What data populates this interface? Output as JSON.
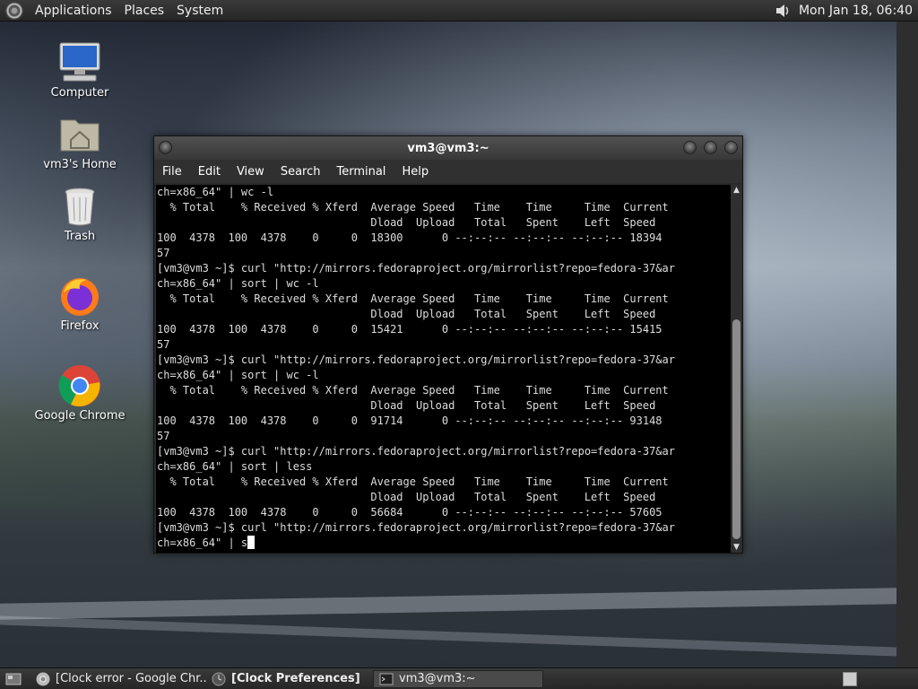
{
  "top_panel": {
    "menus": [
      "Applications",
      "Places",
      "System"
    ],
    "clock": "Mon Jan 18, 06:40"
  },
  "desktop_icons": [
    {
      "label": "Computer",
      "icon": "computer-icon"
    },
    {
      "label": "vm3's Home",
      "icon": "home-folder-icon"
    },
    {
      "label": "Trash",
      "icon": "trash-icon"
    },
    {
      "label": "Firefox",
      "icon": "firefox-icon"
    },
    {
      "label": "Google Chrome",
      "icon": "chrome-icon"
    }
  ],
  "terminal": {
    "title": "vm3@vm3:~",
    "menus": [
      "File",
      "Edit",
      "View",
      "Search",
      "Terminal",
      "Help"
    ],
    "lines": [
      "ch=x86_64\" | wc -l",
      "  % Total    % Received % Xferd  Average Speed   Time    Time     Time  Current",
      "                                 Dload  Upload   Total   Spent    Left  Speed",
      "100  4378  100  4378    0     0  18300      0 --:--:-- --:--:-- --:--:-- 18394",
      "57",
      "[vm3@vm3 ~]$ curl \"http://mirrors.fedoraproject.org/mirrorlist?repo=fedora-37&ar",
      "ch=x86_64\" | sort | wc -l",
      "  % Total    % Received % Xferd  Average Speed   Time    Time     Time  Current",
      "                                 Dload  Upload   Total   Spent    Left  Speed",
      "100  4378  100  4378    0     0  15421      0 --:--:-- --:--:-- --:--:-- 15415",
      "57",
      "[vm3@vm3 ~]$ curl \"http://mirrors.fedoraproject.org/mirrorlist?repo=fedora-37&ar",
      "ch=x86_64\" | sort | wc -l",
      "  % Total    % Received % Xferd  Average Speed   Time    Time     Time  Current",
      "                                 Dload  Upload   Total   Spent    Left  Speed",
      "100  4378  100  4378    0     0  91714      0 --:--:-- --:--:-- --:--:-- 93148",
      "57",
      "[vm3@vm3 ~]$ curl \"http://mirrors.fedoraproject.org/mirrorlist?repo=fedora-37&ar",
      "ch=x86_64\" | sort | less",
      "  % Total    % Received % Xferd  Average Speed   Time    Time     Time  Current",
      "                                 Dload  Upload   Total   Spent    Left  Speed",
      "100  4378  100  4378    0     0  56684      0 --:--:-- --:--:-- --:--:-- 57605",
      "[vm3@vm3 ~]$ curl \"http://mirrors.fedoraproject.org/mirrorlist?repo=fedora-37&ar"
    ],
    "current_input": "ch=x86_64\" | s"
  },
  "taskbar": {
    "tasks": [
      {
        "label": "[Clock error - Google Chr...",
        "icon": "chrome-icon"
      },
      {
        "label": "[Clock Preferences]",
        "icon": "clock-icon"
      },
      {
        "label": "vm3@vm3:~",
        "icon": "terminal-icon"
      }
    ]
  }
}
